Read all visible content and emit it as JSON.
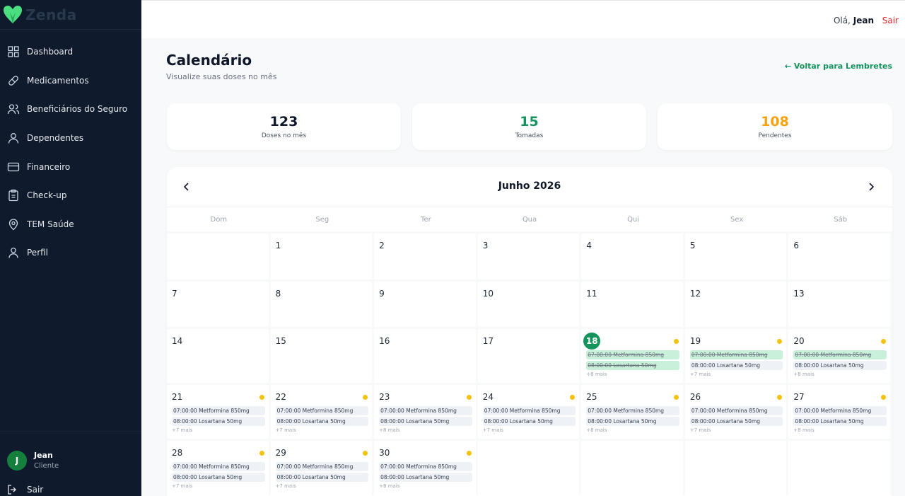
{
  "app": {
    "name": "Zenda"
  },
  "sidebar": {
    "items": [
      {
        "label": "Dashboard",
        "icon": "grid-icon"
      },
      {
        "label": "Medicamentos",
        "icon": "pill-icon"
      },
      {
        "label": "Beneficiários do Seguro",
        "icon": "users-icon"
      },
      {
        "label": "Dependentes",
        "icon": "user-icon"
      },
      {
        "label": "Financeiro",
        "icon": "card-icon"
      },
      {
        "label": "Check-up",
        "icon": "clipboard-icon"
      },
      {
        "label": "TEM Saúde",
        "icon": "pin-icon"
      },
      {
        "label": "Perfil",
        "icon": "profile-icon"
      }
    ],
    "user": {
      "initial": "J",
      "name": "Jean",
      "role": "Cliente"
    },
    "logout_label": "Sair"
  },
  "topbar": {
    "greeting_prefix": "Olá, ",
    "greeting_name": "Jean",
    "logout_label": "Sair"
  },
  "header": {
    "title": "Calendário",
    "subtitle": "Visualize suas doses no mês",
    "back_link": "← Voltar para Lembretes"
  },
  "stats": [
    {
      "value": "123",
      "label": "Doses no mês",
      "color": "#0f172a"
    },
    {
      "value": "15",
      "label": "Tomadas",
      "color": "#15935d"
    },
    {
      "value": "108",
      "label": "Pendentes",
      "color": "#f4a20d"
    }
  ],
  "calendar": {
    "month_label": "Junho 2026",
    "weekdays": [
      "Dom",
      "Seg",
      "Ter",
      "Qua",
      "Qui",
      "Sex",
      "Sáb"
    ],
    "rows": [
      [
        {
          "day": ""
        },
        {
          "day": "1"
        },
        {
          "day": "2"
        },
        {
          "day": "3"
        },
        {
          "day": "4"
        },
        {
          "day": "5"
        },
        {
          "day": "6"
        }
      ],
      [
        {
          "day": "7"
        },
        {
          "day": "8"
        },
        {
          "day": "9"
        },
        {
          "day": "10"
        },
        {
          "day": "11"
        },
        {
          "day": "12"
        },
        {
          "day": "13"
        }
      ],
      [
        {
          "day": "14"
        },
        {
          "day": "15"
        },
        {
          "day": "16"
        },
        {
          "day": "17"
        },
        {
          "day": "18",
          "today": true,
          "dot": true,
          "doses": [
            {
              "text": "07:00:00 Metformina 850mg",
              "taken": true
            },
            {
              "text": "08:00:00 Losartana 50mg",
              "taken": true
            }
          ],
          "more": "+8 mais"
        },
        {
          "day": "19",
          "dot": true,
          "doses": [
            {
              "text": "07:00:00 Metformina 850mg",
              "taken": true
            },
            {
              "text": "08:00:00 Losartana 50mg",
              "taken": false
            }
          ],
          "more": "+7 mais"
        },
        {
          "day": "20",
          "dot": true,
          "doses": [
            {
              "text": "07:00:00 Metformina 850mg",
              "taken": true
            },
            {
              "text": "08:00:00 Losartana 50mg",
              "taken": false
            }
          ],
          "more": "+8 mais"
        }
      ],
      [
        {
          "day": "21",
          "dot": true,
          "doses": [
            {
              "text": "07:00:00 Metformina 850mg"
            },
            {
              "text": "08:00:00 Losartana 50mg"
            }
          ],
          "more": "+7 mais"
        },
        {
          "day": "22",
          "dot": true,
          "doses": [
            {
              "text": "07:00:00 Metformina 850mg"
            },
            {
              "text": "08:00:00 Losartana 50mg"
            }
          ],
          "more": "+7 mais"
        },
        {
          "day": "23",
          "dot": true,
          "doses": [
            {
              "text": "07:00:00 Metformina 850mg"
            },
            {
              "text": "08:00:00 Losartana 50mg"
            }
          ],
          "more": "+8 mais"
        },
        {
          "day": "24",
          "dot": true,
          "doses": [
            {
              "text": "07:00:00 Metformina 850mg"
            },
            {
              "text": "08:00:00 Losartana 50mg"
            }
          ],
          "more": "+7 mais"
        },
        {
          "day": "25",
          "dot": true,
          "doses": [
            {
              "text": "07:00:00 Metformina 850mg"
            },
            {
              "text": "08:00:00 Losartana 50mg"
            }
          ],
          "more": "+8 mais"
        },
        {
          "day": "26",
          "dot": true,
          "doses": [
            {
              "text": "07:00:00 Metformina 850mg"
            },
            {
              "text": "08:00:00 Losartana 50mg"
            }
          ],
          "more": "+7 mais"
        },
        {
          "day": "27",
          "dot": true,
          "doses": [
            {
              "text": "07:00:00 Metformina 850mg"
            },
            {
              "text": "08:00:00 Losartana 50mg"
            }
          ],
          "more": "+8 mais"
        }
      ],
      [
        {
          "day": "28",
          "dot": true,
          "doses": [
            {
              "text": "07:00:00 Metformina 850mg"
            },
            {
              "text": "08:00:00 Losartana 50mg"
            }
          ],
          "more": "+7 mais"
        },
        {
          "day": "29",
          "dot": true,
          "doses": [
            {
              "text": "07:00:00 Metformina 850mg"
            },
            {
              "text": "08:00:00 Losartana 50mg"
            }
          ],
          "more": "+7 mais"
        },
        {
          "day": "30",
          "dot": true,
          "doses": [
            {
              "text": "07:00:00 Metformina 850mg"
            },
            {
              "text": "08:00:00 Losartana 50mg"
            }
          ],
          "more": "+8 mais"
        },
        {
          "day": ""
        },
        {
          "day": ""
        },
        {
          "day": ""
        },
        {
          "day": ""
        }
      ]
    ]
  }
}
